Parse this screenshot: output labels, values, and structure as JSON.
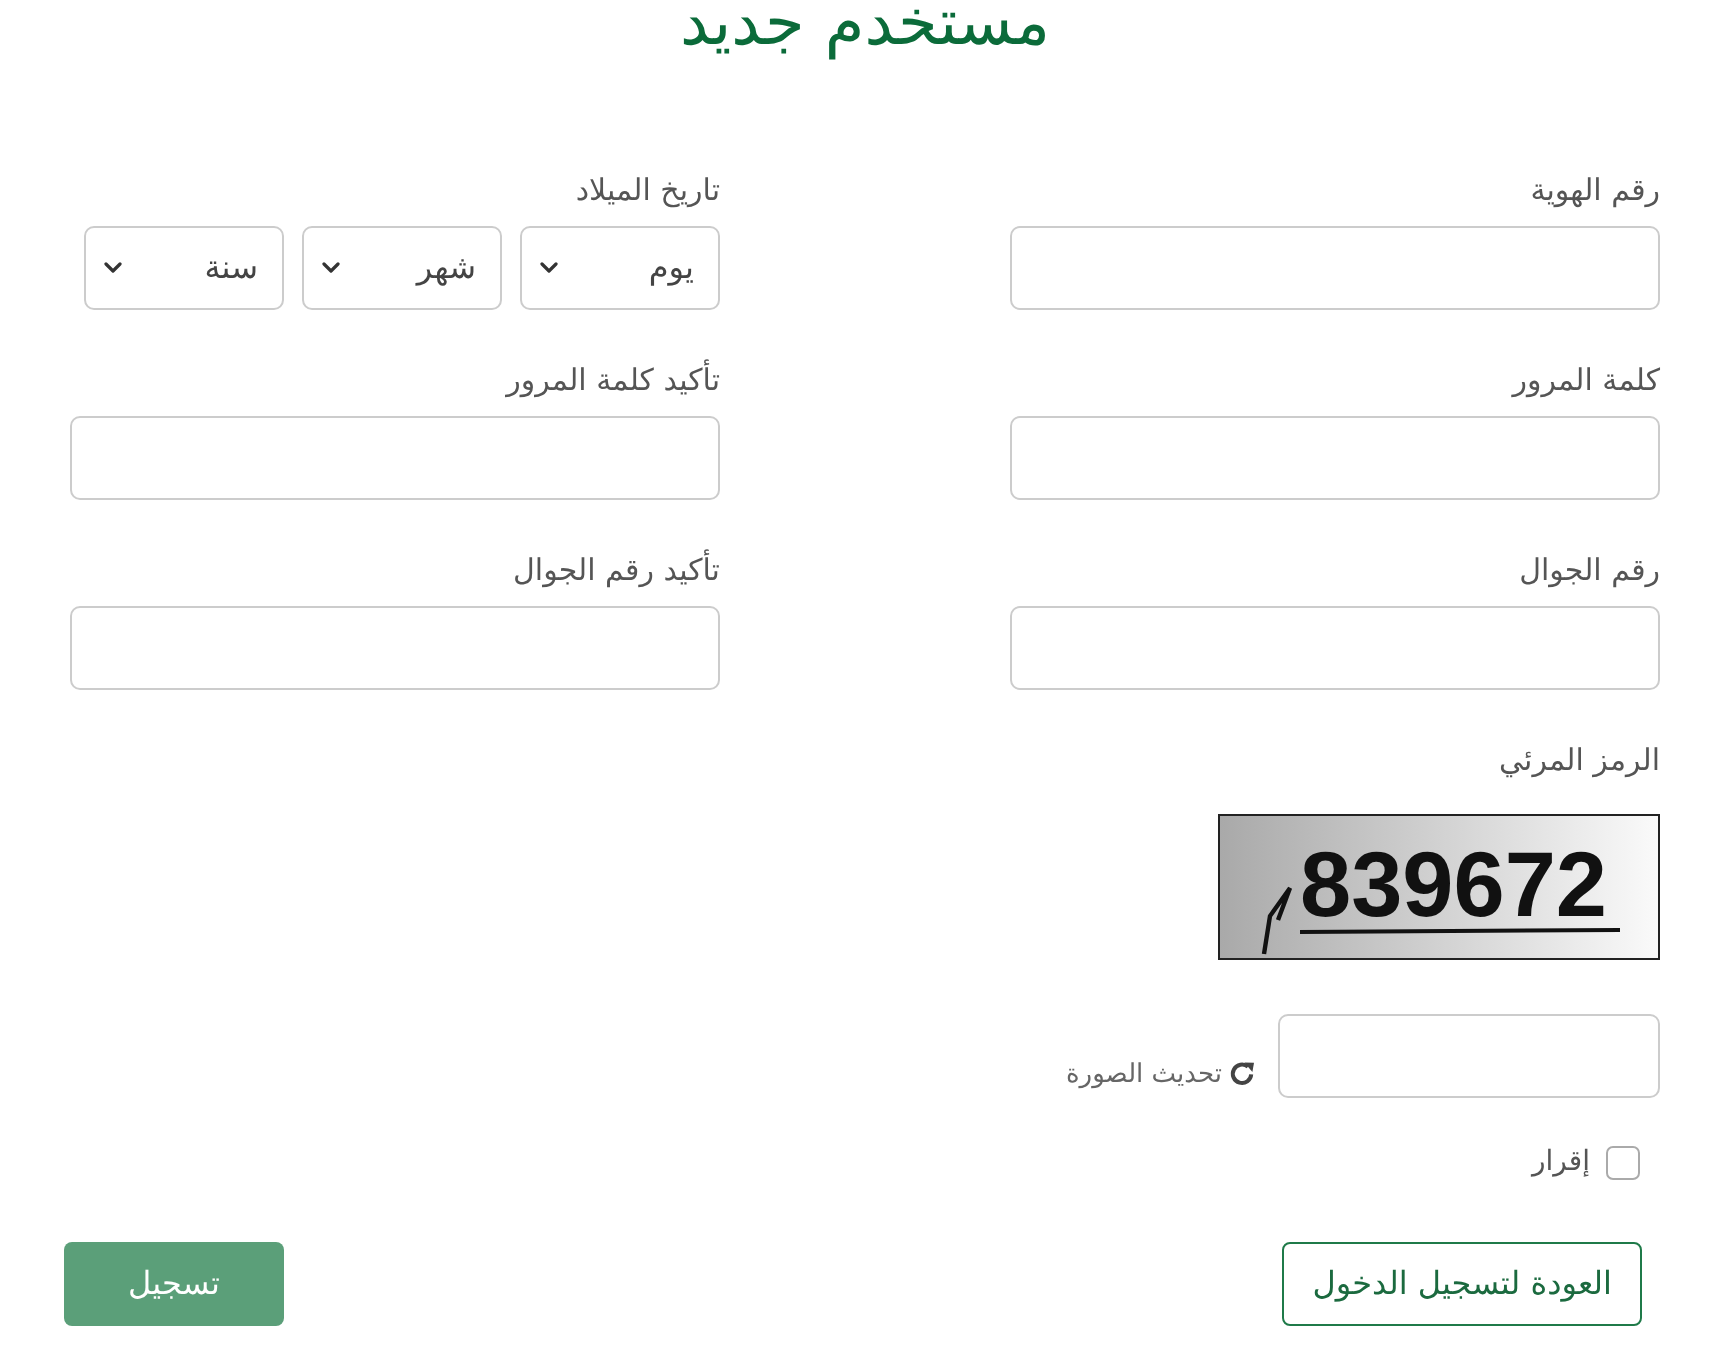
{
  "title": "مستخدم جديد",
  "fields": [
    {
      "kind": "input",
      "label": "رقم الهوية"
    },
    {
      "kind": "date",
      "label": "تاريخ الميلاد",
      "selects": [
        {
          "placeholder": "يوم"
        },
        {
          "placeholder": "شهر"
        },
        {
          "placeholder": "سنة"
        }
      ]
    },
    {
      "kind": "input",
      "label": "كلمة المرور"
    },
    {
      "kind": "input",
      "label": "تأكيد كلمة المرور"
    },
    {
      "kind": "input",
      "label": "رقم الجوال"
    },
    {
      "kind": "input",
      "label": "تأكيد رقم الجوال"
    }
  ],
  "captcha": {
    "label": "الرمز المرئي",
    "code": "839672",
    "refresh": "تحديث الصورة"
  },
  "agreement": {
    "label": "إقرار",
    "checked": false
  },
  "buttons": [
    {
      "kind": "outline",
      "label": "العودة لتسجيل الدخول"
    },
    {
      "kind": "primary",
      "label": "تسجيل"
    }
  ]
}
